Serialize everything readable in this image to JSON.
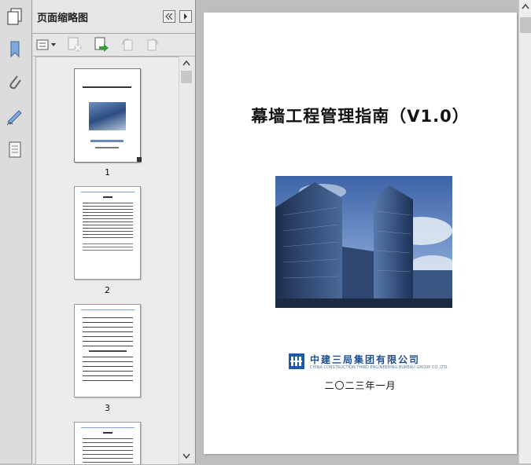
{
  "panel": {
    "title": "页面缩略图",
    "thumbnails": [
      {
        "label": "1"
      },
      {
        "label": "2"
      },
      {
        "label": "3"
      }
    ]
  },
  "document": {
    "title": "幕墙工程管理指南（V1.0）",
    "company_cn": "中建三局集团有限公司",
    "company_en": "CHINA CONSTRUCTION THIRD ENGINEERING BUREAU GROUP CO.,LTD.",
    "date": "二〇二三年一月"
  },
  "colors": {
    "brand": "#1c5aa6",
    "panel_bg": "#e6e6e6",
    "doc_bg": "#bdbdbd"
  },
  "icons": {
    "left_toolbar": [
      "pages-icon",
      "bookmark-icon",
      "attachment-icon",
      "signature-icon",
      "layers-icon"
    ],
    "panel_toolbar": [
      "options-menu-icon",
      "delete-page-icon",
      "insert-page-icon",
      "rotate-ccw-icon",
      "rotate-cw-icon"
    ]
  }
}
